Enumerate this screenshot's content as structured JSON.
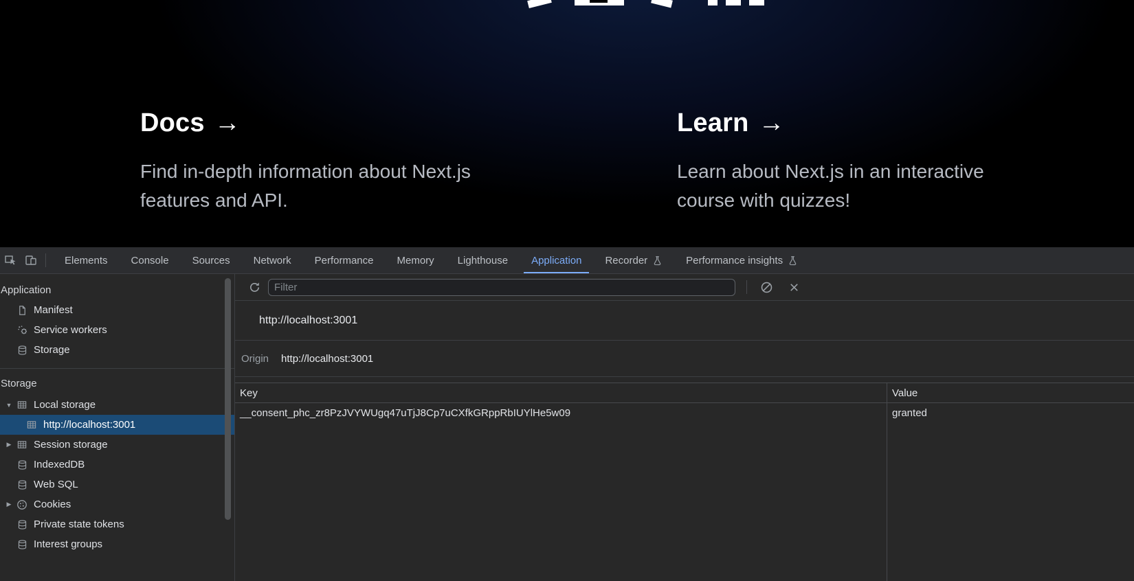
{
  "hero": {
    "docs_title": "Docs",
    "docs_arrow": "→",
    "docs_description": "Find in-depth information about Next.js features and API.",
    "learn_title": "Learn",
    "learn_arrow": "→",
    "learn_description": "Learn about Next.js in an interactive course with quizzes!"
  },
  "devtools": {
    "colors": {
      "accent": "#7cacf8",
      "selection": "#1b4b76"
    },
    "tabs": [
      {
        "label": "Elements"
      },
      {
        "label": "Console"
      },
      {
        "label": "Sources"
      },
      {
        "label": "Network"
      },
      {
        "label": "Performance"
      },
      {
        "label": "Memory"
      },
      {
        "label": "Lighthouse"
      },
      {
        "label": "Application",
        "active": true
      },
      {
        "label": "Recorder",
        "experimental": true
      },
      {
        "label": "Performance insights",
        "experimental": true
      }
    ],
    "sidebar": {
      "sections": [
        {
          "header": "Application",
          "items": [
            {
              "label": "Manifest",
              "icon": "document"
            },
            {
              "label": "Service workers",
              "icon": "service-worker"
            },
            {
              "label": "Storage",
              "icon": "database"
            }
          ]
        },
        {
          "header": "Storage",
          "items": [
            {
              "label": "Local storage",
              "icon": "table",
              "expander": "open"
            },
            {
              "label": "http://localhost:3001",
              "icon": "table",
              "child": true,
              "selected": true
            },
            {
              "label": "Session storage",
              "icon": "table",
              "expander": "closed"
            },
            {
              "label": "IndexedDB",
              "icon": "database"
            },
            {
              "label": "Web SQL",
              "icon": "database"
            },
            {
              "label": "Cookies",
              "icon": "cookie",
              "expander": "closed"
            },
            {
              "label": "Private state tokens",
              "icon": "database"
            },
            {
              "label": "Interest groups",
              "icon": "database"
            }
          ]
        }
      ]
    },
    "main": {
      "filter_placeholder": "Filter",
      "origin_header": "http://localhost:3001",
      "origin_label": "Origin",
      "origin_value": "http://localhost:3001",
      "table": {
        "columns": [
          "Key",
          "Value"
        ],
        "rows": [
          {
            "key": "__consent_phc_zr8PzJVYWUgq47uTjJ8Cp7uCXfkGRppRbIUYlHe5w09",
            "value": "granted"
          }
        ]
      }
    }
  }
}
